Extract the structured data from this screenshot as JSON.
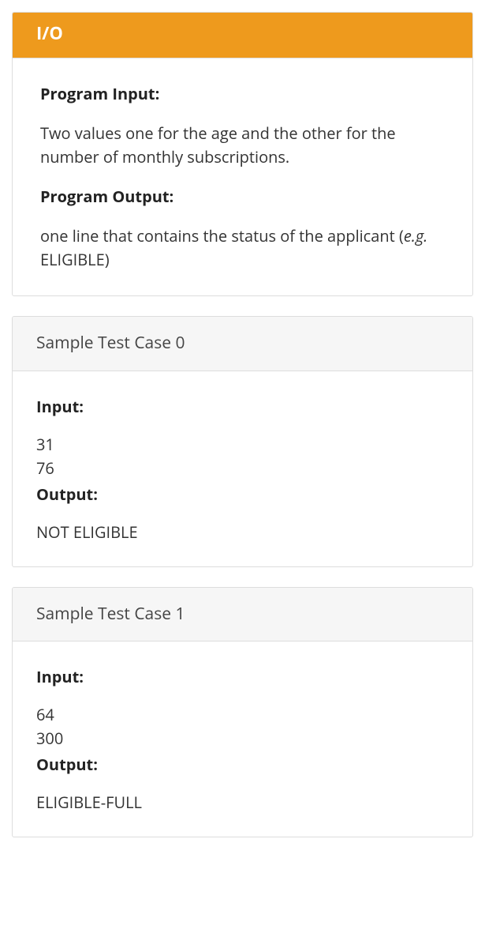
{
  "spec": {
    "header": "I/O",
    "inputLabel": "Program Input:",
    "inputDesc": "Two values one for the age and the other for the number of monthly subscriptions.",
    "outputLabel": "Program Output:",
    "outputDescPrefix": "one line that contains the status of the applicant (",
    "outputDescItalic": "e.g.",
    "outputDescSuffix": " ELIGIBLE)"
  },
  "tests": [
    {
      "title": "Sample Test Case 0",
      "inputLabel": "Input:",
      "inputValue": "31\n76",
      "outputLabel": "Output:",
      "outputValue": "NOT ELIGIBLE"
    },
    {
      "title": "Sample Test Case 1",
      "inputLabel": "Input:",
      "inputValue": "64\n300",
      "outputLabel": "Output:",
      "outputValue": "ELIGIBLE-FULL"
    }
  ]
}
